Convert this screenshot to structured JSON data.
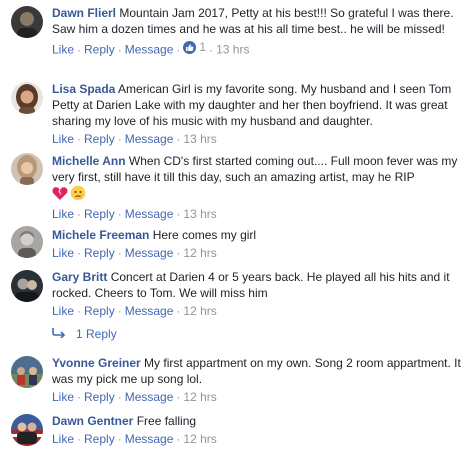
{
  "comments": [
    {
      "author": "Dawn Flierl",
      "text": "Mountain Jam 2017, Petty at his best!!! So grateful I was there. Saw him a dozen times and he was at his all time best.. he will be missed!",
      "time": "13 hrs",
      "like_count": "1",
      "avatar_colors": [
        "#3a3a3a",
        "#8a7a68"
      ]
    },
    {
      "author": "Lisa Spada",
      "text": "American Girl is my favorite song. My husband and I seen Tom Petty at Darien Lake with my daughter and her then boyfriend. It was great sharing my love of his music with my husband and daughter.",
      "time": "13 hrs",
      "avatar_colors": [
        "#5a3b2a",
        "#d9a889"
      ]
    },
    {
      "author": "Michelle Ann",
      "text": "When CD's first started coming out.... Full moon fever was my very first, still have it till this day, such an amazing artist, may he RIP",
      "time": "13 hrs",
      "emojis": [
        "broken-heart-icon",
        "crying-face-icon"
      ],
      "avatar_colors": [
        "#b89878",
        "#e8c7a8"
      ]
    },
    {
      "author": "Michele Freeman",
      "text": "Here comes my girl",
      "time": "12 hrs",
      "avatar_colors": [
        "#7d7a78",
        "#d4cfc9"
      ]
    },
    {
      "author": "Gary Britt",
      "text": "Concert at Darien 4 or 5 years back. He played all his hits and it rocked. Cheers to Tom. We will miss him",
      "time": "12 hrs",
      "avatar_colors": [
        "#2b2f36",
        "#a8a29a"
      ]
    },
    {
      "author": "Yvonne Greiner",
      "text": "My first appartment on my own. Song 2 room appartment. It was my pick me up song lol.",
      "time": "12 hrs",
      "avatar_colors": [
        "#4f6d8c",
        "#c9a98a"
      ]
    },
    {
      "author": "Dawn Gentner",
      "text": "Free falling",
      "time": "12 hrs",
      "avatar_colors": [
        "#9b2c2c",
        "#3b5b99"
      ]
    }
  ],
  "actions": {
    "like": "Like",
    "reply": "Reply",
    "message": "Message",
    "separator": "·"
  },
  "replies_link": "1 Reply",
  "colors": {
    "link": "#4267b2",
    "author": "#385898",
    "meta": "#90949c",
    "text": "#1d2129"
  }
}
